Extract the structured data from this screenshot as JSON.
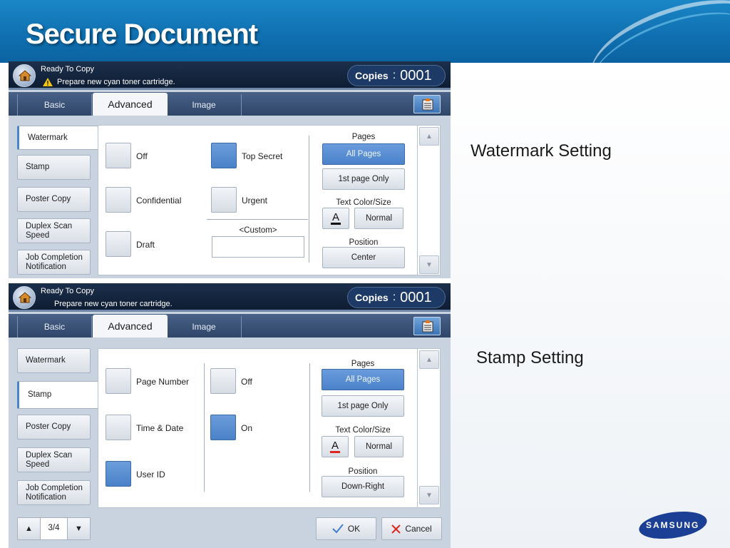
{
  "slide": {
    "title": "Secure Document",
    "caption_watermark": "Watermark Setting",
    "caption_stamp": "Stamp Setting",
    "logo_text": "SAMSUNG"
  },
  "panel1": {
    "status": {
      "line1": "Ready To Copy",
      "line2": "Prepare new cyan toner cartridge."
    },
    "copies": {
      "label": "Copies",
      "colon": ":",
      "value": "0001"
    },
    "tabs": {
      "basic": "Basic",
      "advanced": "Advanced",
      "image": "Image"
    },
    "sidebar": [
      "Watermark",
      "Stamp",
      "Poster Copy",
      "Duplex Scan Speed",
      "Job Completion Notification"
    ],
    "active_sidebar": "Watermark",
    "options_col1": [
      {
        "label": "Off",
        "checked": false
      },
      {
        "label": "Confidential",
        "checked": false
      },
      {
        "label": "Draft",
        "checked": false
      }
    ],
    "options_col2": [
      {
        "label": "Top Secret",
        "checked": true
      },
      {
        "label": "Urgent",
        "checked": false
      }
    ],
    "custom_label": "<Custom>",
    "custom_value": "",
    "pages": {
      "title": "Pages",
      "all": "All Pages",
      "first": "1st page Only",
      "selected": "All Pages"
    },
    "text_color_size": {
      "title": "Text Color/Size",
      "color_glyph": "A",
      "color": "#111111",
      "size": "Normal"
    },
    "position": {
      "title": "Position",
      "value": "Center"
    }
  },
  "panel2": {
    "status": {
      "line1": "Ready To Copy",
      "line2": "Prepare new cyan toner cartridge."
    },
    "copies": {
      "label": "Copies",
      "colon": ":",
      "value": "0001"
    },
    "tabs": {
      "basic": "Basic",
      "advanced": "Advanced",
      "image": "Image"
    },
    "sidebar": [
      "Watermark",
      "Stamp",
      "Poster Copy",
      "Duplex Scan Speed",
      "Job Completion Notification"
    ],
    "active_sidebar": "Stamp",
    "options_col1": [
      {
        "label": "Page Number",
        "checked": false
      },
      {
        "label": "Time & Date",
        "checked": false
      },
      {
        "label": "User ID",
        "checked": true
      }
    ],
    "options_col2": [
      {
        "label": "Off",
        "checked": false
      },
      {
        "label": "On",
        "checked": true
      }
    ],
    "pages": {
      "title": "Pages",
      "all": "All Pages",
      "first": "1st page Only",
      "selected": "All Pages"
    },
    "text_color_size": {
      "title": "Text Color/Size",
      "color_glyph": "A",
      "color": "#e1261c",
      "size": "Normal"
    },
    "position": {
      "title": "Position",
      "value": "Down-Right"
    },
    "pager": "3/4",
    "ok_label": "OK",
    "cancel_label": "Cancel"
  },
  "colors": {
    "header_blue": "#0f6fb0",
    "selected_blue": "#4b82c9",
    "status_bar": "#0e1d33",
    "samsung_blue": "#1b3f95"
  }
}
